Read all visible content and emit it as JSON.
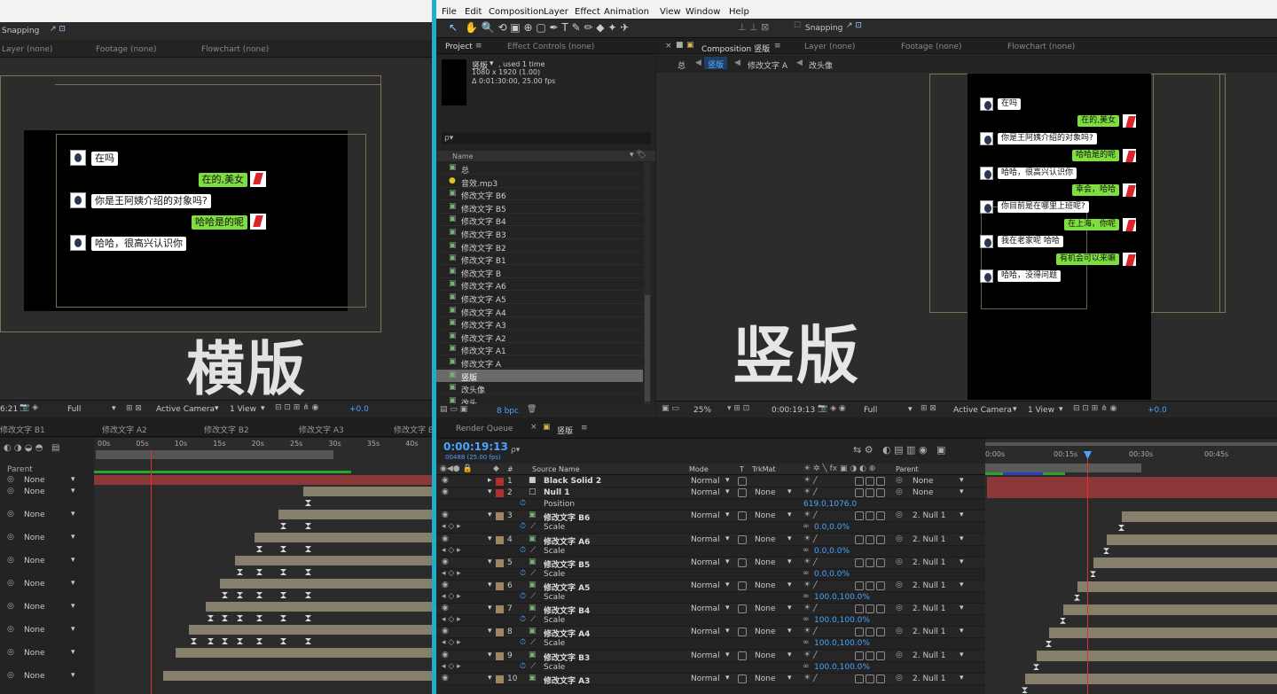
{
  "menu": {
    "items": [
      "File",
      "Edit",
      "Composition",
      "Layer",
      "Effect",
      "Animation",
      "View",
      "Window",
      "Help"
    ]
  },
  "left": {
    "toolbar": {
      "snapping": "Snapping"
    },
    "viewer_tabs": [
      "Layer (none)",
      "Footage (none)",
      "Flowchart (none)"
    ],
    "chat": [
      {
        "side": "left",
        "text": "在吗"
      },
      {
        "side": "right",
        "text": "在的,美女"
      },
      {
        "side": "left",
        "text": "你是王阿姨介绍的对象吗?"
      },
      {
        "side": "right",
        "text": "哈哈是的呢"
      },
      {
        "side": "left",
        "text": "哈哈，很高兴认识你"
      }
    ],
    "big_label": "横版",
    "viewer_footer": {
      "timecode": "6:21",
      "resolution": "Full",
      "camera": "Active Camera",
      "views": "1 View",
      "exposure": "+0.0"
    },
    "timeline_tabs": [
      "修改文字 B1",
      "修改文字 A2",
      "修改文字 B2",
      "修改文字 A3",
      "修改文字 B"
    ],
    "ruler": [
      "00s",
      "05s",
      "10s",
      "15s",
      "20s",
      "25s",
      "30s",
      "35s",
      "40s"
    ],
    "parent_header": "Parent",
    "parents": [
      "None",
      "None",
      "None",
      "None",
      "None",
      "None",
      "None",
      "None",
      "None",
      "None"
    ]
  },
  "project": {
    "tabs": [
      "Project",
      "Effect Controls (none)"
    ],
    "item_name": "竖版",
    "used": ", used 1 time",
    "dims": "1080 x 1920 (1.00)",
    "duration": "Δ 0:01:30:00, 25.00 fps",
    "search_placeholder": "ρ▾",
    "name_header": "Name",
    "items": [
      "总",
      "音效.mp3",
      "修改文字 B6",
      "修改文字 B5",
      "修改文字 B4",
      "修改文字 B3",
      "修改文字 B2",
      "修改文字 B1",
      "修改文字 B",
      "修改文字 A6",
      "修改文字 A5",
      "修改文字 A4",
      "修改文字 A3",
      "修改文字 A2",
      "修改文字 A1",
      "修改文字 A",
      "竖版",
      "改头像",
      "改头..."
    ],
    "bpc": "8 bpc"
  },
  "comp": {
    "tabs": [
      "Composition 竖版",
      "Layer (none)",
      "Footage (none)",
      "Flowchart (none)"
    ],
    "breadcrumb": [
      "总",
      "竖版",
      "修改文字 A",
      "改头像"
    ],
    "big_label": "竖版",
    "chat": [
      {
        "side": "left",
        "text": "在吗"
      },
      {
        "side": "right",
        "text": "在的,美女"
      },
      {
        "side": "left",
        "text": "你是王阿姨介绍的对象吗?"
      },
      {
        "side": "right",
        "text": "哈哈是的呢"
      },
      {
        "side": "left",
        "text": "哈哈，很高兴认识你"
      },
      {
        "side": "right",
        "text": "幸会，哈哈"
      },
      {
        "side": "left",
        "text": "你目前是在哪里上班呢?"
      },
      {
        "side": "right",
        "text": "在上海，你呢"
      },
      {
        "side": "left",
        "text": "我在老家呢 哈哈"
      },
      {
        "side": "right",
        "text": "有机会可以来嘛"
      },
      {
        "side": "left",
        "text": "哈哈，没得问题"
      }
    ],
    "footer": {
      "zoom": "25%",
      "timecode": "0:00:19:13",
      "resolution": "Full",
      "camera": "Active Camera",
      "views": "1 View",
      "exposure": "+0.0"
    }
  },
  "timeline": {
    "tabs": [
      "Render Queue",
      "竖版"
    ],
    "timecode": "0:00:19:13",
    "fps": "00488 (25.00 fps)",
    "headers": {
      "num": "#",
      "source": "Source Name",
      "mode": "Mode",
      "t": "T",
      "trkmat": "TrkMat",
      "parent": "Parent"
    },
    "ruler": [
      "0:00s",
      "00:15s",
      "00:30s",
      "00:45s"
    ],
    "rows": [
      {
        "kind": "layer",
        "num": "1",
        "name": "Black Solid 2",
        "mode": "Normal",
        "trkmat": "",
        "parent": "None"
      },
      {
        "kind": "layer",
        "num": "2",
        "name": "Null 1",
        "mode": "Normal",
        "trkmat": "None",
        "parent": "None"
      },
      {
        "kind": "prop",
        "name": "Position",
        "value": "619.0,1076.0"
      },
      {
        "kind": "layer",
        "num": "3",
        "name": "修改文字 B6",
        "mode": "Normal",
        "trkmat": "None",
        "parent": "2. Null 1"
      },
      {
        "kind": "prop",
        "name": "Scale",
        "value": "0.0,0.0%"
      },
      {
        "kind": "layer",
        "num": "4",
        "name": "修改文字 A6",
        "mode": "Normal",
        "trkmat": "None",
        "parent": "2. Null 1"
      },
      {
        "kind": "prop",
        "name": "Scale",
        "value": "0.0,0.0%"
      },
      {
        "kind": "layer",
        "num": "5",
        "name": "修改文字 B5",
        "mode": "Normal",
        "trkmat": "None",
        "parent": "2. Null 1"
      },
      {
        "kind": "prop",
        "name": "Scale",
        "value": "0.0,0.0%"
      },
      {
        "kind": "layer",
        "num": "6",
        "name": "修改文字 A5",
        "mode": "Normal",
        "trkmat": "None",
        "parent": "2. Null 1"
      },
      {
        "kind": "prop",
        "name": "Scale",
        "value": "100.0,100.0%"
      },
      {
        "kind": "layer",
        "num": "7",
        "name": "修改文字 B4",
        "mode": "Normal",
        "trkmat": "None",
        "parent": "2. Null 1"
      },
      {
        "kind": "prop",
        "name": "Scale",
        "value": "100.0,100.0%"
      },
      {
        "kind": "layer",
        "num": "8",
        "name": "修改文字 A4",
        "mode": "Normal",
        "trkmat": "None",
        "parent": "2. Null 1"
      },
      {
        "kind": "prop",
        "name": "Scale",
        "value": "100.0,100.0%"
      },
      {
        "kind": "layer",
        "num": "9",
        "name": "修改文字 B3",
        "mode": "Normal",
        "trkmat": "None",
        "parent": "2. Null 1"
      },
      {
        "kind": "prop",
        "name": "Scale",
        "value": "100.0,100.0%"
      },
      {
        "kind": "layer",
        "num": "10",
        "name": "修改文字 A3",
        "mode": "Normal",
        "trkmat": "None",
        "parent": "2. Null 1"
      }
    ]
  },
  "colors": {
    "accent": "#4aa3ff",
    "playhead": "#e03030",
    "chat_green": "#7ede3f",
    "bar": "#857f6b"
  }
}
